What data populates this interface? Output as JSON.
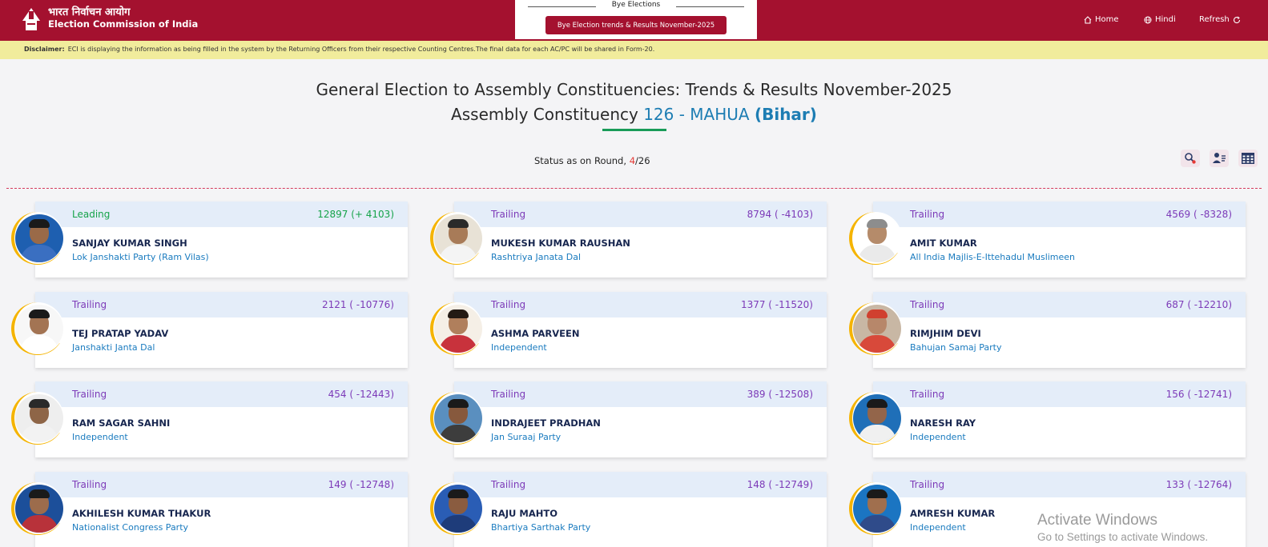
{
  "header": {
    "logo_hindi": "भारत निर्वाचन आयोग",
    "logo_english": "Election Commission of India",
    "bye_title": "Bye Elections",
    "bye_button": "Bye Election trends & Results November-2025",
    "nav": {
      "home": "Home",
      "hindi": "Hindi",
      "refresh": "Refresh"
    },
    "brand_color": "#a4112f"
  },
  "disclaimer": {
    "label": "Disclaimer:",
    "text": "ECI is displaying the information as being filled in the system by the Returning Officers from their respective Counting Centres.The final data for each AC/PC will be shared in Form-20."
  },
  "page": {
    "title_line1": "General Election to Assembly Constituencies: Trends & Results November-2025",
    "title_prefix": "Assembly Constituency",
    "constituency": "126 - MAHUA",
    "state": "(Bihar)",
    "status_label": "Status as on Round,",
    "round_current": "4",
    "round_total": "/26"
  },
  "icons": {
    "home": "home-icon",
    "hindi": "globe-icon",
    "refresh": "refresh-icon",
    "tools": [
      "candidate-search-icon",
      "user-list-icon",
      "table-grid-icon"
    ]
  },
  "colors": {
    "leading": "#16a34a",
    "trailing": "#7c3ab8",
    "party": "#1a7bbf",
    "avatar_ring": "#f5b400"
  },
  "candidates": [
    {
      "status": "Leading",
      "votes": "12897 (+ 4103)",
      "name": "SANJAY KUMAR SINGH",
      "party": "Lok Janshakti Party (Ram Vilas)",
      "photo": {
        "bg": "#1e5fb0",
        "skin": "#9a6a48",
        "hair": "#1a1a1a",
        "cloth": "#3a6fc1"
      }
    },
    {
      "status": "Trailing",
      "votes": "8794 ( -4103)",
      "name": "MUKESH KUMAR RAUSHAN",
      "party": "Rashtriya Janata Dal",
      "photo": {
        "bg": "#e8e2d6",
        "skin": "#a87b58",
        "hair": "#2a2a2a",
        "cloth": "#f4f4f4"
      }
    },
    {
      "status": "Trailing",
      "votes": "4569 ( -8328)",
      "name": "AMIT KUMAR",
      "party": "All India Majlis-E-Ittehadul Muslimeen",
      "photo": {
        "bg": "#ffffff",
        "skin": "#b58b6a",
        "hair": "#8d8d8d",
        "cloth": "#eaeaea"
      }
    },
    {
      "status": "Trailing",
      "votes": "2121 ( -10776)",
      "name": "TEJ PRATAP YADAV",
      "party": "Janshakti Janta Dal",
      "photo": {
        "bg": "#f7f7f7",
        "skin": "#a37453",
        "hair": "#1a1a1a",
        "cloth": "#ffffff"
      }
    },
    {
      "status": "Trailing",
      "votes": "1377 ( -11520)",
      "name": "ASHMA PARVEEN",
      "party": "Independent",
      "photo": {
        "bg": "#f5efe6",
        "skin": "#b07f5c",
        "hair": "#231a14",
        "cloth": "#c8323c"
      }
    },
    {
      "status": "Trailing",
      "votes": "687 ( -12210)",
      "name": "RIMJHIM DEVI",
      "party": "Bahujan Samaj Party",
      "photo": {
        "bg": "#c8b7a4",
        "skin": "#b7876a",
        "hair": "#d0402f",
        "cloth": "#d8493a"
      }
    },
    {
      "status": "Trailing",
      "votes": "454 ( -12443)",
      "name": "RAM SAGAR SAHNI",
      "party": "Independent",
      "photo": {
        "bg": "#eeeeee",
        "skin": "#8e6547",
        "hair": "#2a2a2a",
        "cloth": "#f2f2f2"
      }
    },
    {
      "status": "Trailing",
      "votes": "389 ( -12508)",
      "name": "INDRAJEET PRADHAN",
      "party": "Jan Suraaj Party",
      "photo": {
        "bg": "#5a8fbf",
        "skin": "#87593d",
        "hair": "#1a1a1a",
        "cloth": "#3d3d3d"
      }
    },
    {
      "status": "Trailing",
      "votes": "156 ( -12741)",
      "name": "NARESH RAY",
      "party": "Independent",
      "photo": {
        "bg": "#1f6fb8",
        "skin": "#93654a",
        "hair": "#1a1a1a",
        "cloth": "#f0f0f0"
      }
    },
    {
      "status": "Trailing",
      "votes": "149 ( -12748)",
      "name": "AKHILESH KUMAR THAKUR",
      "party": "Nationalist Congress Party",
      "photo": {
        "bg": "#1c4f9a",
        "skin": "#9c6c4c",
        "hair": "#1a1a1a",
        "cloth": "#b8323a"
      }
    },
    {
      "status": "Trailing",
      "votes": "148 ( -12749)",
      "name": "RAJU MAHTO",
      "party": "Bhartiya Sarthak Party",
      "photo": {
        "bg": "#2a5db5",
        "skin": "#8a5c40",
        "hair": "#1a1a1a",
        "cloth": "#1e3c7a"
      }
    },
    {
      "status": "Trailing",
      "votes": "133 ( -12764)",
      "name": "AMRESH KUMAR",
      "party": "Independent",
      "photo": {
        "bg": "#1b75c2",
        "skin": "#a06f4e",
        "hair": "#1a1a1a",
        "cloth": "#2f4b8a"
      }
    }
  ],
  "watermark": {
    "line1": "Activate Windows",
    "line2": "Go to Settings to activate Windows."
  }
}
